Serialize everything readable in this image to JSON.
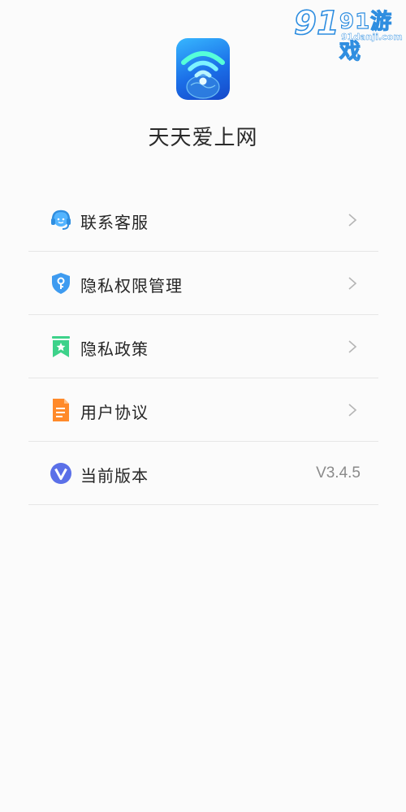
{
  "watermark": {
    "brand": "91游戏",
    "domain": "91danji.com"
  },
  "app": {
    "icon": "wifi-globe-icon",
    "title": "天天爱上网"
  },
  "menu": [
    {
      "label": "联系客服",
      "icon": "customer-service-headset-icon",
      "has_chevron": true
    },
    {
      "label": "隐私权限管理",
      "icon": "shield-key-icon",
      "has_chevron": true
    },
    {
      "label": "隐私政策",
      "icon": "bookmark-star-icon",
      "has_chevron": true
    },
    {
      "label": "用户协议",
      "icon": "document-icon",
      "has_chevron": true
    },
    {
      "label": "当前版本",
      "icon": "version-v-icon",
      "value": "V3.4.5"
    }
  ],
  "colors": {
    "background": "#fbfbfb",
    "accent_blue": "#2f8ee0",
    "shield_blue": "#3e9bf0",
    "bookmark_green": "#3dd28a",
    "document_orange": "#ff8a2a",
    "version_purple": "#5b70e8"
  }
}
